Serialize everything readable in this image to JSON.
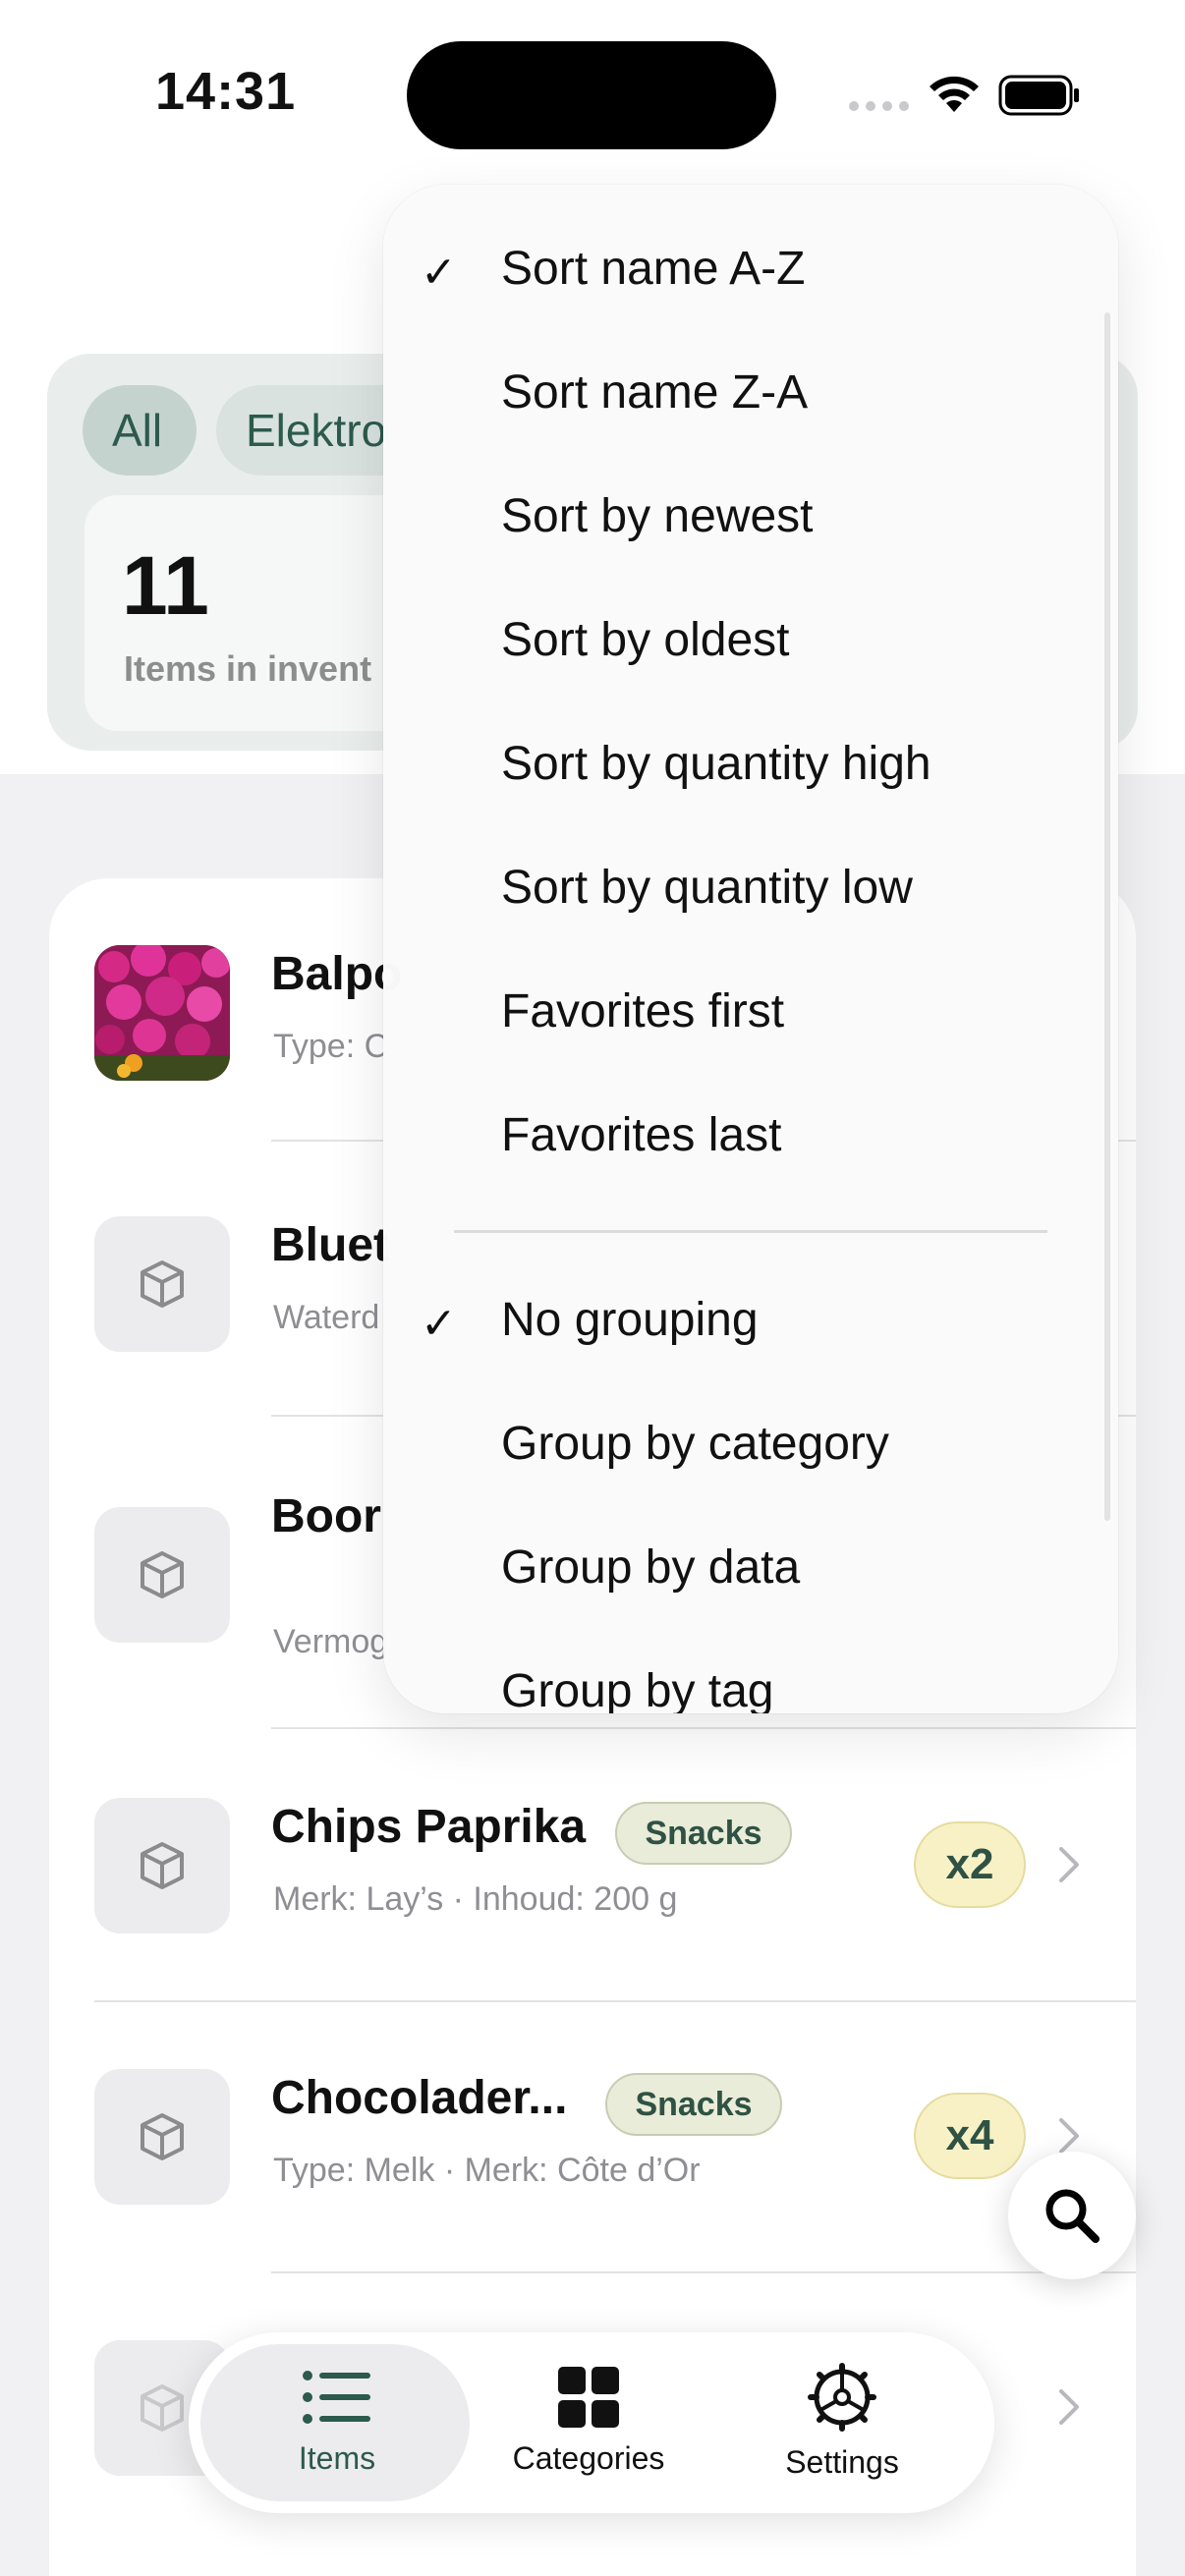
{
  "status_bar": {
    "time": "14:31"
  },
  "filters": {
    "chips": [
      "All",
      "Elektro"
    ],
    "stat_value": "11",
    "stat_label": "Items in invent"
  },
  "items": [
    {
      "title": "Balpo",
      "subtitle": "Type: C",
      "has_photo": true
    },
    {
      "title": "Bluet",
      "subtitle": "Waterd"
    },
    {
      "title": "Boor",
      "subtitle": "Vermog"
    },
    {
      "title": "Chips Paprika",
      "badge": "Snacks",
      "subtitle": "Merk: Lay’s · Inhoud: 200 g",
      "qty": "x2"
    },
    {
      "title": "Chocolader...",
      "badge": "Snacks",
      "subtitle": "Type: Melk · Merk: Côte d’Or",
      "qty": "x4"
    }
  ],
  "sort_menu": {
    "sort_options": [
      {
        "label": "Sort name A-Z",
        "checked": true
      },
      {
        "label": "Sort name Z-A",
        "checked": false
      },
      {
        "label": "Sort by newest",
        "checked": false
      },
      {
        "label": "Sort by oldest",
        "checked": false
      },
      {
        "label": "Sort by quantity high",
        "checked": false
      },
      {
        "label": "Sort by quantity low",
        "checked": false
      },
      {
        "label": "Favorites first",
        "checked": false
      },
      {
        "label": "Favorites last",
        "checked": false
      }
    ],
    "group_options": [
      {
        "label": "No grouping",
        "checked": true
      },
      {
        "label": "Group by category",
        "checked": false
      },
      {
        "label": "Group by data",
        "checked": false
      },
      {
        "label": "Group by tag",
        "checked": false
      }
    ],
    "check_glyph": "✓"
  },
  "tab_bar": {
    "tabs": [
      {
        "label": "Items",
        "icon": "list-icon",
        "active": true
      },
      {
        "label": "Categories",
        "icon": "grid-icon",
        "active": false
      },
      {
        "label": "Settings",
        "icon": "gear-icon",
        "active": false
      }
    ]
  },
  "colors": {
    "accent": "#2c5a4c",
    "badge_bg": "#e9ecd8",
    "qty_bg": "#f8f1c5"
  }
}
